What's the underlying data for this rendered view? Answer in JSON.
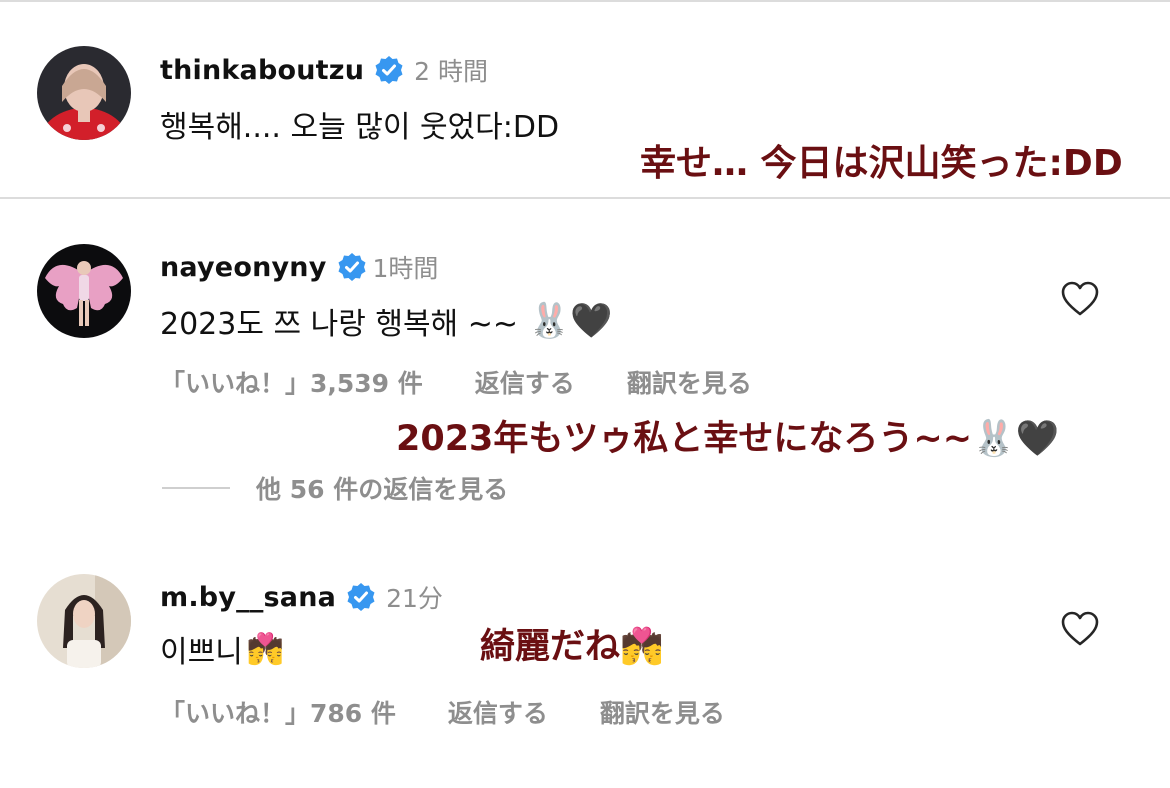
{
  "comments": [
    {
      "username": "thinkaboutzu",
      "time": "2 時間",
      "text": "행복해.... 오늘 많이 웃었다:DD",
      "translation": "幸せ… 今日は沢山笑った:DD"
    },
    {
      "username": "nayeonyny",
      "time": "1時間",
      "text": "2023도 쯔 나랑 행복해 ~~",
      "emoji": "🐰🖤",
      "likes": "「いいね！」3,539 件",
      "reply": "返信する",
      "see_translation": "翻訳を見る",
      "translation": "2023年もツゥ私と幸せになろう~~🐰🖤",
      "view_replies": "他 56 件の返信を見る"
    },
    {
      "username": "m.by__sana",
      "time": "21分",
      "text": "이쁘니",
      "emoji": "💏",
      "likes": "「いいね！」786 件",
      "reply": "返信する",
      "see_translation": "翻訳を見る",
      "translation": "綺麗だね💏"
    }
  ],
  "colors": {
    "verified": "#3797f0",
    "secondary_text": "#8e8e8e",
    "translation": "#6a0f12"
  }
}
